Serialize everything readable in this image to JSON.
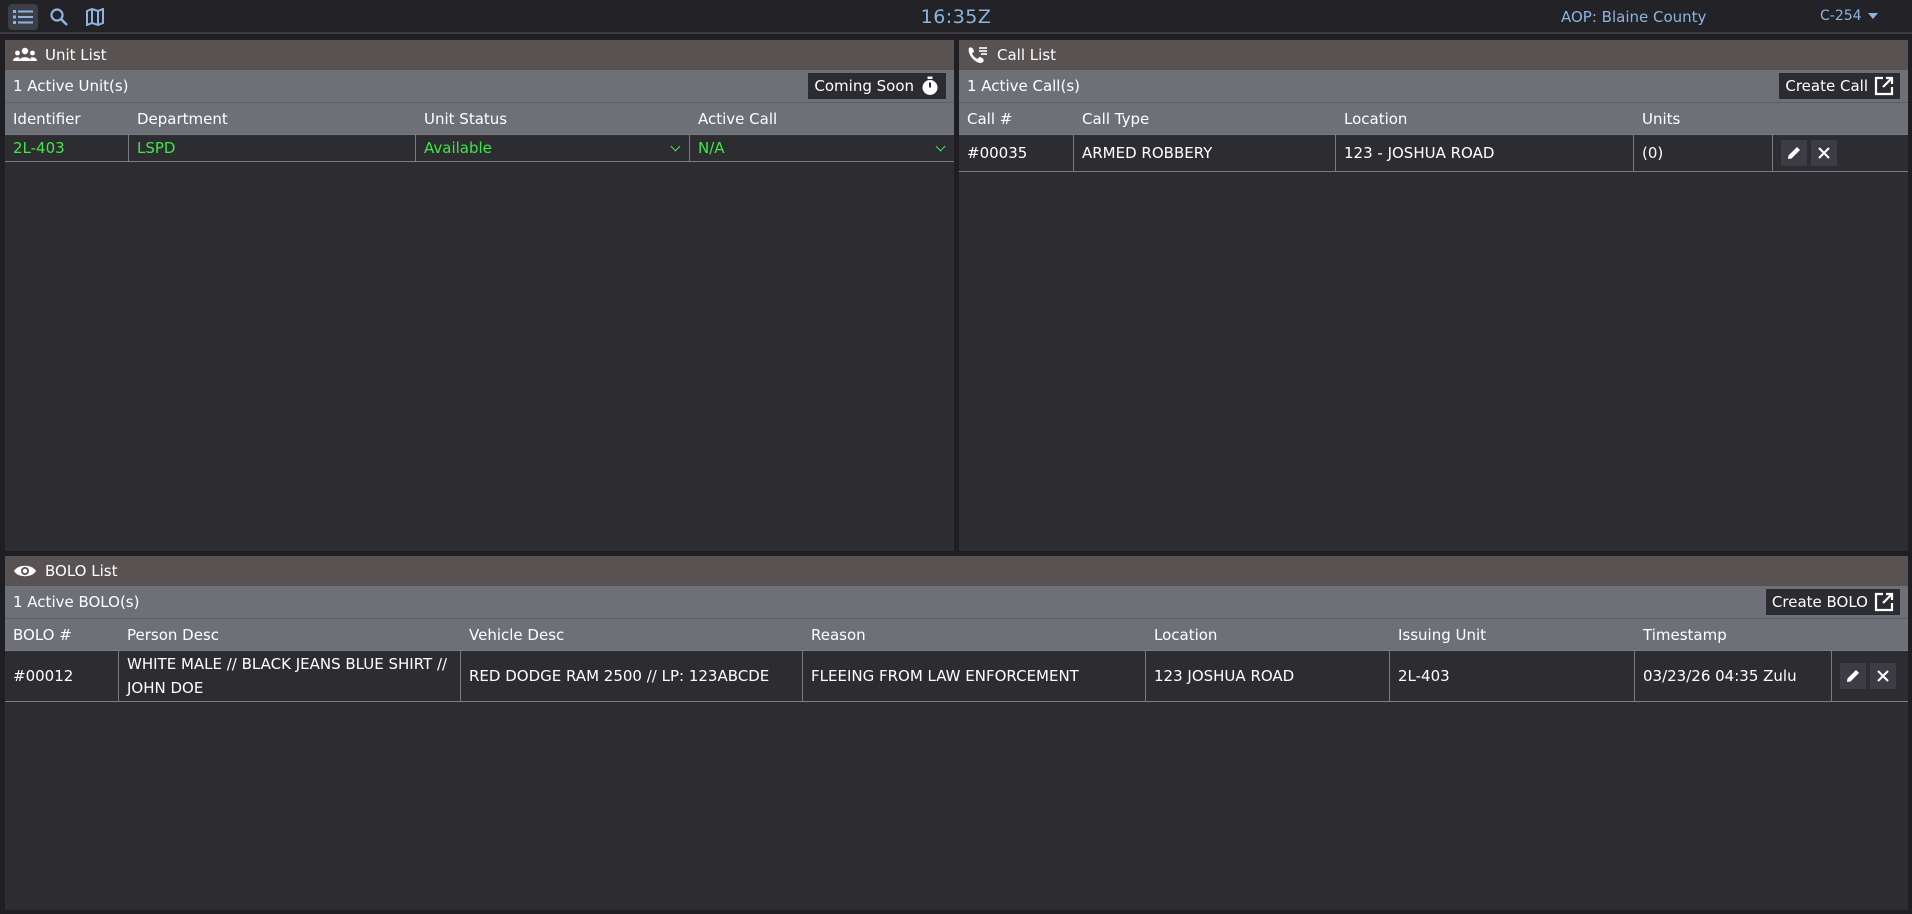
{
  "topbar": {
    "clock": "16:35Z",
    "aop": "AOP: Blaine County",
    "user": "C-254",
    "icons": [
      "list-icon",
      "search-icon",
      "map-icon"
    ]
  },
  "unit_list": {
    "title": "Unit List",
    "count": "1 Active Unit(s)",
    "button": "Coming Soon",
    "columns": [
      "Identifier",
      "Department",
      "Unit Status",
      "Active Call"
    ],
    "rows": [
      {
        "identifier": "2L-403",
        "department": "LSPD",
        "status": "Available",
        "call": "N/A"
      }
    ]
  },
  "call_list": {
    "title": "Call List",
    "count": "1 Active Call(s)",
    "button": "Create Call",
    "columns": [
      "Call #",
      "Call Type",
      "Location",
      "Units"
    ],
    "rows": [
      {
        "number": "#00035",
        "type": "ARMED ROBBERY",
        "location": "123 - JOSHUA ROAD",
        "units": "(0)"
      }
    ]
  },
  "bolo_list": {
    "title": "BOLO List",
    "count": "1 Active BOLO(s)",
    "button": "Create BOLO",
    "columns": [
      "BOLO #",
      "Person Desc",
      "Vehicle Desc",
      "Reason",
      "Location",
      "Issuing Unit",
      "Timestamp"
    ],
    "rows": [
      {
        "number": "#00012",
        "person": "WHITE MALE // BLACK JEANS BLUE SHIRT // JOHN DOE",
        "vehicle": "RED DODGE RAM 2500 // LP: 123ABCDE",
        "reason": "FLEEING FROM LAW ENFORCEMENT",
        "location": "123 JOSHUA ROAD",
        "unit": "2L-403",
        "timestamp": "03/23/26 04:35 Zulu"
      }
    ]
  },
  "colors": {
    "accent_text": "#8db4e0",
    "status_green": "#3ee64b",
    "title_bar": "#585253",
    "header_bar": "#6e7077",
    "panel_bg": "#2d2d31"
  }
}
